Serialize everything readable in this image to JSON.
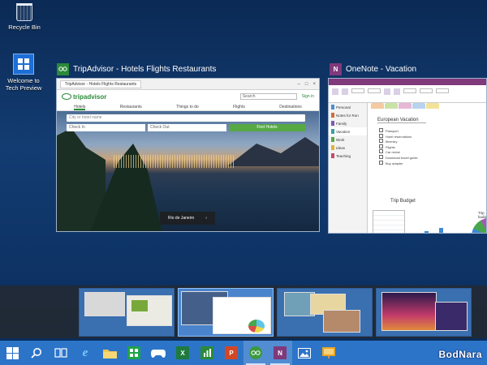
{
  "desktop": {
    "icons": [
      {
        "label": "Recycle Bin",
        "icon": "recycle-bin-icon"
      },
      {
        "label": "Welcome to Tech Preview",
        "icon": "windows-logo-icon"
      }
    ]
  },
  "windows": {
    "tripadvisor": {
      "title": "TripAdvisor - Hotels Flights Restaurants",
      "browser_tab": "TripAdvisor - Hotels Flights Restaurants",
      "logo": "tripadvisor",
      "search": "Search",
      "sign_in": "Sign in",
      "nav": [
        "Hotels",
        "Restaurants",
        "Things to do",
        "Flights",
        "Destinations"
      ],
      "where_placeholder": "City or hotel name",
      "check_in": "Check In",
      "check_out": "Check Out",
      "find": "Find Hotels",
      "caption": "Rio de Janeiro",
      "caption_arrow": "›"
    },
    "onenote": {
      "title": "OneNote - Vacation",
      "app_badge": "N",
      "notebooks": [
        "Personal",
        "Notes for Ron",
        "Family",
        "Vacation",
        "Work",
        "Ideas",
        "Teaching"
      ],
      "page_title": "European Vacation",
      "list": [
        "Passport",
        "Hotel reservations",
        "Itinerary",
        "Flights",
        "Car rental",
        "Download travel guide",
        "Buy adapter"
      ],
      "budget_title": "Trip Budget",
      "pie_title": "Trip budget"
    }
  },
  "taskbar": {
    "items": [
      {
        "name": "start-button",
        "icon": "windows-logo-icon",
        "active": false
      },
      {
        "name": "search-button",
        "icon": "search-icon",
        "active": false
      },
      {
        "name": "task-view-button",
        "icon": "task-view-icon",
        "active": false
      },
      {
        "name": "internet-explorer",
        "icon": "ie-icon",
        "active": false
      },
      {
        "name": "file-explorer",
        "icon": "folder-icon",
        "active": false
      },
      {
        "name": "windows-store",
        "icon": "store-icon",
        "active": false
      },
      {
        "name": "xbox",
        "icon": "game-controller-icon",
        "active": false
      },
      {
        "name": "excel",
        "icon": "excel-icon",
        "active": false
      },
      {
        "name": "excel-chart",
        "icon": "chart-icon",
        "active": false
      },
      {
        "name": "powerpoint",
        "icon": "powerpoint-icon",
        "active": false
      },
      {
        "name": "tripadvisor-app",
        "icon": "tripadvisor-icon",
        "active": true
      },
      {
        "name": "onenote-app",
        "icon": "onenote-icon",
        "active": true
      },
      {
        "name": "photos-app",
        "icon": "photos-icon",
        "active": false
      },
      {
        "name": "slides-app",
        "icon": "slides-icon",
        "active": false
      }
    ],
    "brand": "BodNara"
  },
  "colors": {
    "accent": "#2c74c8",
    "onenote": "#80397b",
    "tripadvisor": "#2a8a3a"
  }
}
